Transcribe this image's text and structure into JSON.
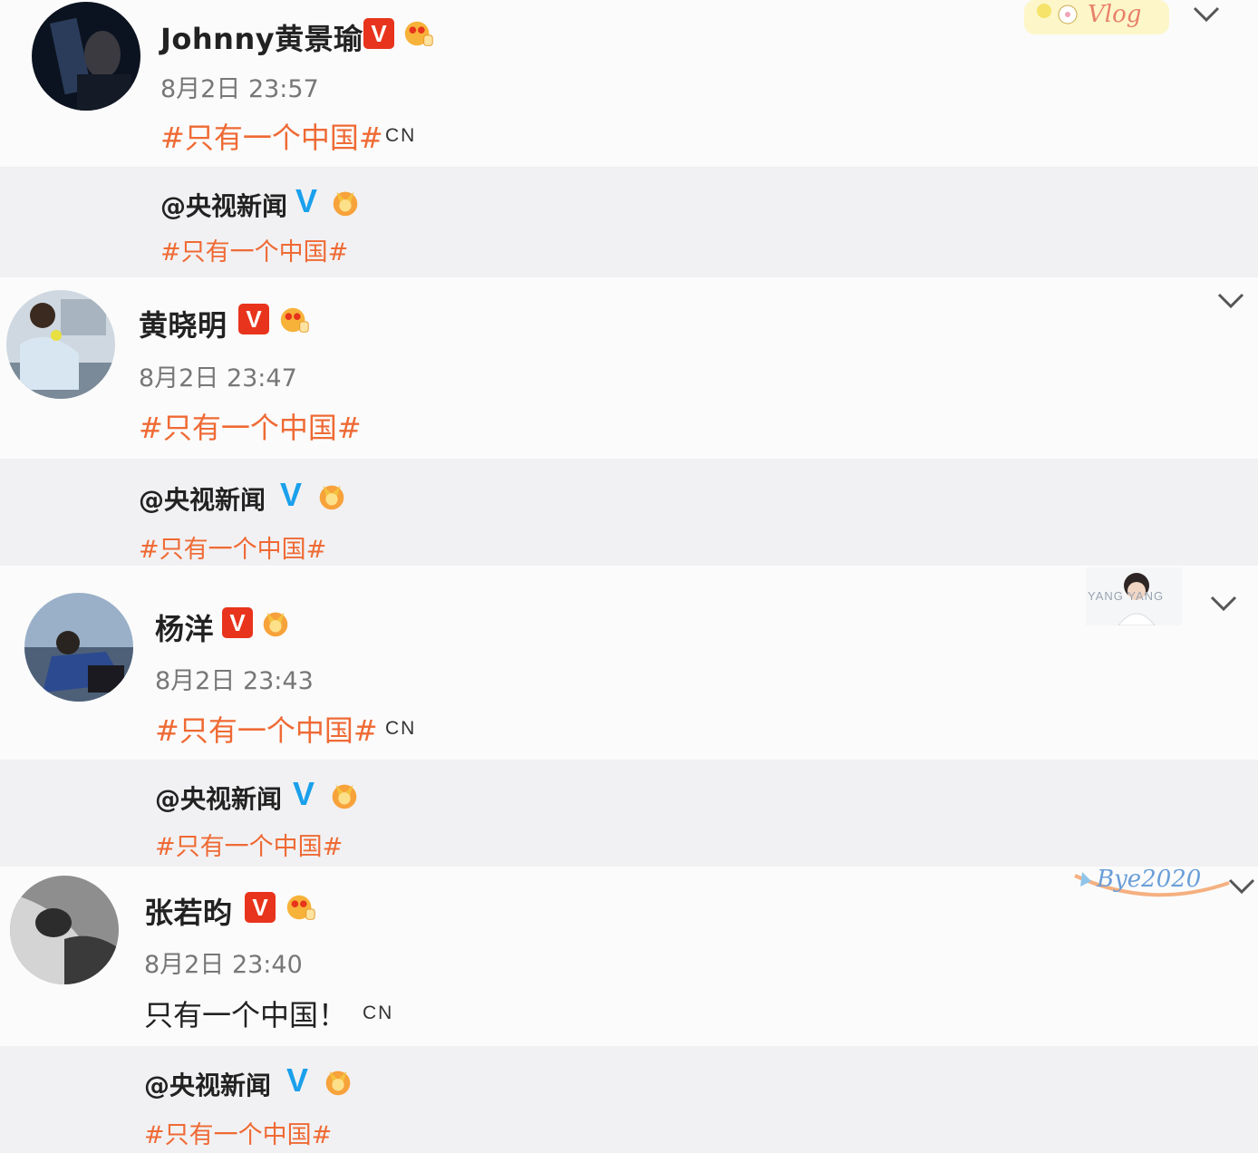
{
  "posts": [
    {
      "username": "Johnny黄景瑜",
      "verified": "V",
      "time": "8月2日 23:57",
      "text": "#只有一个中国#",
      "suffix": "CN",
      "decoration": "Vlog",
      "repost": {
        "username": "@央视新闻",
        "verified": "V",
        "text": "#只有一个中国#"
      }
    },
    {
      "username": "黄晓明",
      "verified": "V",
      "time": "8月2日 23:47",
      "text": "#只有一个中国#",
      "repost": {
        "username": "@央视新闻",
        "verified": "V",
        "text": "#只有一个中国#"
      }
    },
    {
      "username": "杨洋",
      "verified": "V",
      "time": "8月2日 23:43",
      "text": "#只有一个中国#",
      "suffix": "CN",
      "decoration": "YANG YANG",
      "repost": {
        "username": "@央视新闻",
        "verified": "V",
        "text": "#只有一个中国#"
      }
    },
    {
      "username": "张若昀",
      "verified": "V",
      "time": "8月2日 23:40",
      "text": "只有一个中国！",
      "suffix": "CN",
      "decoration": "Bye2020",
      "repost": {
        "username": "@央视新闻",
        "verified": "V",
        "text": "#只有一个中国#"
      }
    }
  ],
  "icons": {
    "chevron": "chevron-down-icon",
    "medal": "medal-icon",
    "verified": "verified-v-icon"
  },
  "colors": {
    "topic": "#ef6a34",
    "verified_red": "#e8341c",
    "verified_blue": "#1aa0ec",
    "repost_bg": "#f1f1f3"
  }
}
